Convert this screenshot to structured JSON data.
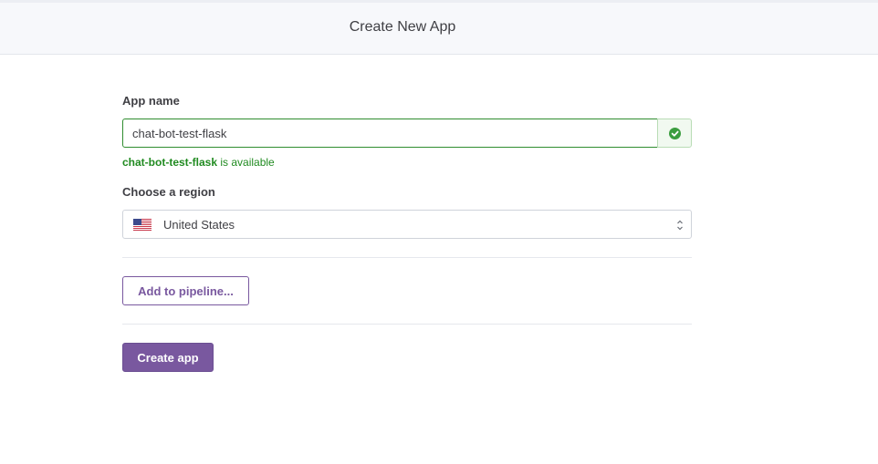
{
  "header": {
    "title": "Create New App"
  },
  "form": {
    "app_name_label": "App name",
    "app_name_value": "chat-bot-test-flask",
    "availability": {
      "name": "chat-bot-test-flask",
      "suffix": " is available",
      "status": "valid"
    },
    "region_label": "Choose a region",
    "region": {
      "selected": "United States",
      "flag_icon": "us-flag-icon"
    },
    "pipeline_button_label": "Add to pipeline...",
    "create_button_label": "Create app"
  },
  "colors": {
    "accent": "#79589f",
    "success": "#2f8d2f",
    "header_bg": "#f7f8fb"
  }
}
